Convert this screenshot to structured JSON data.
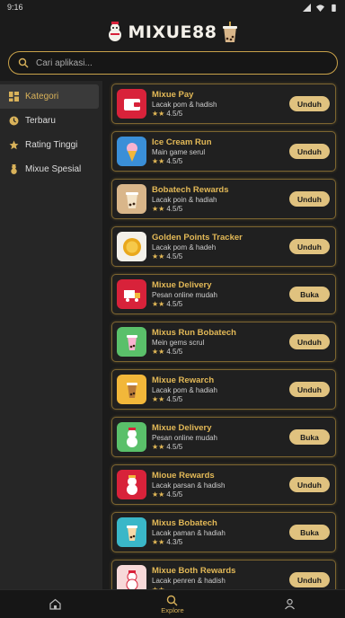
{
  "status": {
    "time": "9:16"
  },
  "header": {
    "title": "MIXUE88"
  },
  "search": {
    "placeholder": "Cari aplikasi..."
  },
  "sidebar": {
    "items": [
      {
        "label": "Kategori",
        "icon": "grid-icon",
        "active": true
      },
      {
        "label": "Terbaru",
        "icon": "clock-icon"
      },
      {
        "label": "Rating Tinggi",
        "icon": "star-icon"
      },
      {
        "label": "Mixue Spesial",
        "icon": "mascot-icon"
      }
    ]
  },
  "apps": [
    {
      "name": "Mixue Pay",
      "desc": "Lacak pom & hadish",
      "rating": "4.5/5",
      "action": "Unduh",
      "icon": "wallet-icon",
      "color": "#d8223a"
    },
    {
      "name": "Ice Cream Run",
      "desc": "Main game serul",
      "rating": "4.5/5",
      "action": "Unduh",
      "icon": "ice-cream-icon",
      "color": "#3a8fd8"
    },
    {
      "name": "Bobatech Rewards",
      "desc": "Lacak poin & hadiah",
      "rating": "4.5/5",
      "action": "Unduh",
      "icon": "boba-icon",
      "color": "#d9b68a"
    },
    {
      "name": "Golden Points Tracker",
      "desc": "Lacak pom & hadeh",
      "rating": "4.5/5",
      "action": "Unduh",
      "icon": "coin-icon",
      "color": "#f4f1ea"
    },
    {
      "name": "Mixue Delivery",
      "desc": "Pesan online mudah",
      "rating": "4.5/5",
      "action": "Buka",
      "icon": "delivery-icon",
      "color": "#d8223a"
    },
    {
      "name": "Mixus Run Bobatech",
      "desc": "Mein gems scrul",
      "rating": "4.5/5",
      "action": "Unduh",
      "icon": "boba-run-icon",
      "color": "#5ac06a"
    },
    {
      "name": "Mixue Rewarch",
      "desc": "Lacak pom & hadiah",
      "rating": "4.5/5",
      "action": "Unduh",
      "icon": "boba-icon",
      "color": "#f2b73a"
    },
    {
      "name": "Mixue Delivery",
      "desc": "Pesan online mudah",
      "rating": "4.5/5",
      "action": "Buka",
      "icon": "mascot-icon",
      "color": "#5ac06a"
    },
    {
      "name": "Mioue Rewards",
      "desc": "Lacak parsan & hadish",
      "rating": "4.5/5",
      "action": "Unduh",
      "icon": "mascot-icon",
      "color": "#d8223a"
    },
    {
      "name": "Mixus Bobatech",
      "desc": "Lacak paman & hadiah",
      "rating": "4.3/5",
      "action": "Buka",
      "icon": "boba-icon",
      "color": "#3ab7c8"
    },
    {
      "name": "Mixue Both Rewards",
      "desc": "Lacak penren & hadish",
      "rating": "",
      "action": "Unduh",
      "icon": "mascot-icon",
      "color": "#f7d9d9"
    }
  ],
  "bottomnav": {
    "items": [
      {
        "label": "",
        "icon": "home-icon"
      },
      {
        "label": "Explore",
        "icon": "search-icon"
      },
      {
        "label": "",
        "icon": "profile-icon"
      }
    ]
  },
  "colors": {
    "accent": "#d9b25a",
    "button": "#e0c27f",
    "background": "#1b1b1b"
  }
}
